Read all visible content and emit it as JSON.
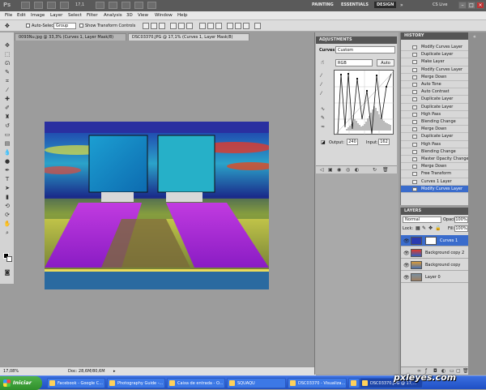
{
  "app": {
    "logo": "Ps",
    "zoom_value": "17,1",
    "workspaces": [
      "PAINTING",
      "ESSENTIALS",
      "DESIGN"
    ],
    "active_workspace": "DESIGN",
    "cs_live": "CS Live",
    "window_buttons": [
      "–",
      "□",
      "×"
    ]
  },
  "menu": [
    "File",
    "Edit",
    "Image",
    "Layer",
    "Select",
    "Filter",
    "Analysis",
    "3D",
    "View",
    "Window",
    "Help"
  ],
  "options": {
    "auto_select_label": "Auto-Select:",
    "auto_select_value": "Group",
    "show_transform_label": "Show Transform Controls"
  },
  "doc_tabs": [
    {
      "label": "0093Nu.jpg @ 33,3% (Curves 1, Layer Mask/8)",
      "active": false
    },
    {
      "label": "DSC03370.JPG @ 17,1% (Curves 1, Layer Mask/8)",
      "active": true
    }
  ],
  "status": {
    "zoom": "17,08%",
    "doc": "Doc: 28,6M/80,6M"
  },
  "adjustments": {
    "title": "ADJUSTMENTS",
    "preset_label": "Curves",
    "preset_value": "Custom",
    "channel_value": "RGB",
    "auto_label": "Auto",
    "output_label": "Output:",
    "output_value": "240",
    "input_label": "Input:",
    "input_value": "162"
  },
  "history": {
    "title": "HISTORY",
    "items": [
      "Modify Curves Layer",
      "Duplicate Layer",
      "Make Layer",
      "Modify Curves Layer",
      "Merge Down",
      "Auto Tone",
      "Auto Contrast",
      "Duplicate Layer",
      "Duplicate Layer",
      "High Pass",
      "Blending Change",
      "Merge Down",
      "Duplicate Layer",
      "High Pass",
      "Blending Change",
      "Master Opacity Change",
      "Merge Down",
      "Free Transform",
      "Curves 1 Layer",
      "Modify Curves Layer"
    ],
    "selected_index": 19
  },
  "layers": {
    "title": "LAYERS",
    "blend_mode": "Normal",
    "opacity_label": "Opacity:",
    "opacity_value": "100%",
    "lock_label": "Lock:",
    "fill_label": "Fill:",
    "fill_value": "100%",
    "items": [
      {
        "name": "Curves 1",
        "selected": true
      },
      {
        "name": "Background copy 2",
        "selected": false
      },
      {
        "name": "Background copy",
        "selected": false
      },
      {
        "name": "Layer 0",
        "selected": false
      }
    ]
  },
  "taskbar": {
    "start": "Iniciar",
    "buttons": [
      "Facebook - Google C...",
      "Photography Guide -...",
      "Caixa de entrada - O...",
      "SQUAQU",
      "DSC03370 - Visualiza...",
      "",
      "DSC03370.JPG @ 17,..."
    ],
    "active_index": 6
  },
  "watermark": "pxleyes.com"
}
